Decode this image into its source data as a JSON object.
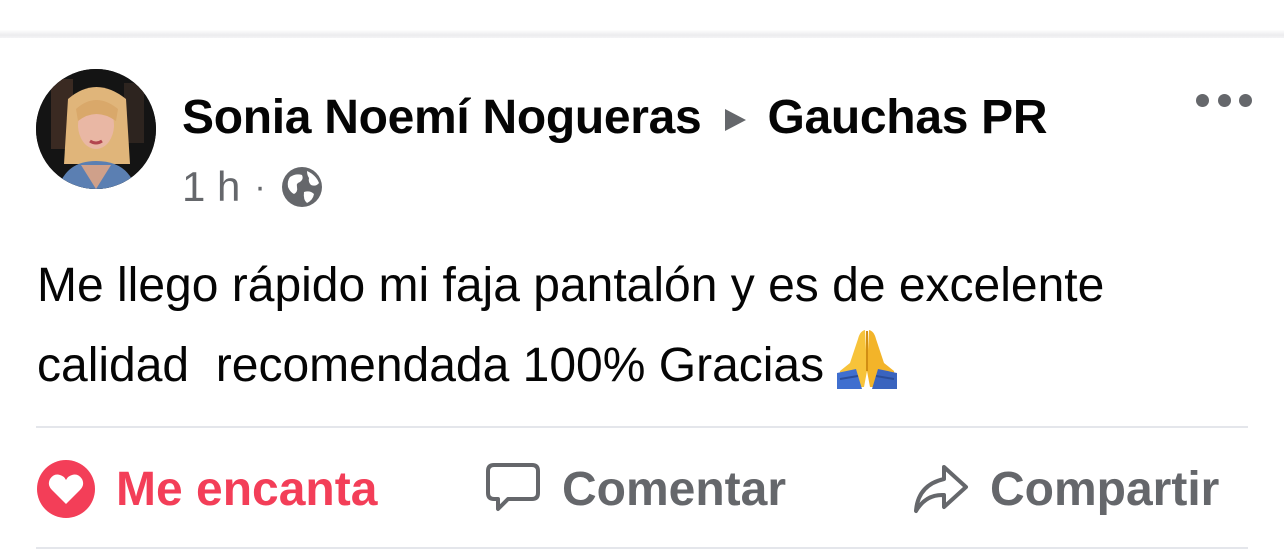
{
  "post": {
    "author": "Sonia Noemí Nogueras",
    "group": "Gauchas PR",
    "time": "1 h",
    "separator": "·",
    "audience_icon": "globe-icon",
    "text": "Me llego rápido mi faja pantalón y es de excelente calidad  recomendada 100% Gracias",
    "emoji": "🙏"
  },
  "actions": {
    "love_label": "Me encanta",
    "comment_label": "Comentar",
    "share_label": "Compartir"
  },
  "colors": {
    "love": "#f33e58",
    "secondary": "#65676b",
    "text": "#050505",
    "divider": "#e4e6eb"
  }
}
